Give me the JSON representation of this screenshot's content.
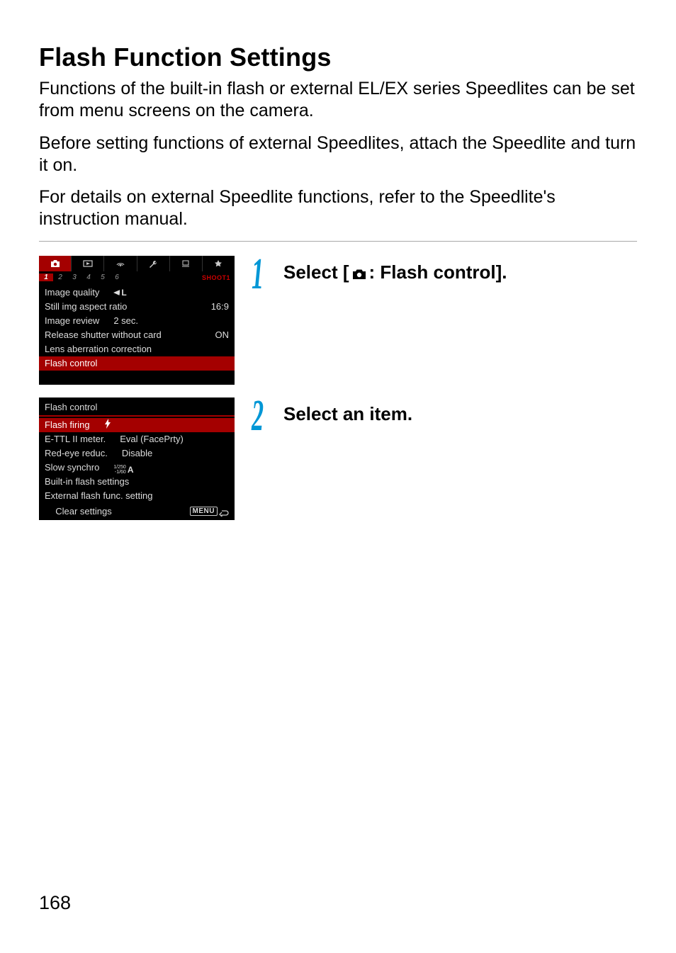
{
  "title": "Flash Function Settings",
  "intro": {
    "p1": "Functions of the built-in flash or external EL/EX series Speedlites can be set from menu screens on the camera.",
    "p2": "Before setting functions of external Speedlites, attach the Speedlite and turn it on.",
    "p3": "For details on external Speedlite functions, refer to the Speedlite's instruction manual."
  },
  "page_number": "168",
  "step1": {
    "num": "1",
    "text_prefix": "Select [",
    "text_suffix": ": Flash control].",
    "screen": {
      "tab_tag": "SHOOT1",
      "subtabs": [
        "1",
        "2",
        "3",
        "4",
        "5",
        "6"
      ],
      "rows": [
        {
          "label": "Image quality",
          "value_sym": "fineL"
        },
        {
          "label": "Still img aspect ratio",
          "value": "16:9"
        },
        {
          "label": "Image review",
          "value_mid": "2 sec."
        },
        {
          "label": "Release shutter without card",
          "value": "ON"
        },
        {
          "label": "Lens aberration correction"
        },
        {
          "label": "Flash control",
          "highlight": true
        }
      ]
    }
  },
  "step2": {
    "num": "2",
    "text": "Select an item.",
    "screen": {
      "heading": "Flash control",
      "rows": [
        {
          "label": "Flash firing",
          "value_sym": "bolt",
          "highlight": true
        },
        {
          "label": "E-TTL II meter.",
          "value_mid": "Eval (FacePrty)"
        },
        {
          "label": "Red-eye reduc.",
          "value_mid": "Disable"
        },
        {
          "label": "Slow synchro",
          "value_sym": "slow"
        },
        {
          "label": "Built-in flash settings"
        },
        {
          "label": "External flash func. setting"
        }
      ],
      "footer": {
        "left": "Clear settings",
        "menu": "MENU"
      }
    }
  }
}
